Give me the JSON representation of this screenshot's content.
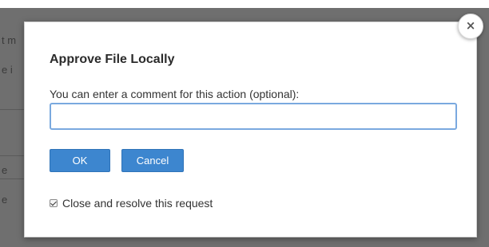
{
  "background": {
    "fragments": [
      "t m",
      "e i",
      "e",
      "e"
    ]
  },
  "dialog": {
    "title": "Approve File Locally",
    "prompt": "You can enter a comment for this action (optional):",
    "comment_value": "",
    "ok_label": "OK",
    "cancel_label": "Cancel",
    "resolve_label": "Close and resolve this request",
    "resolve_checked": true,
    "close_symbol": "×"
  },
  "colors": {
    "primary_button": "#3d86cf",
    "input_focus_border": "#7aa9df",
    "overlay": "#6f6f6f"
  }
}
